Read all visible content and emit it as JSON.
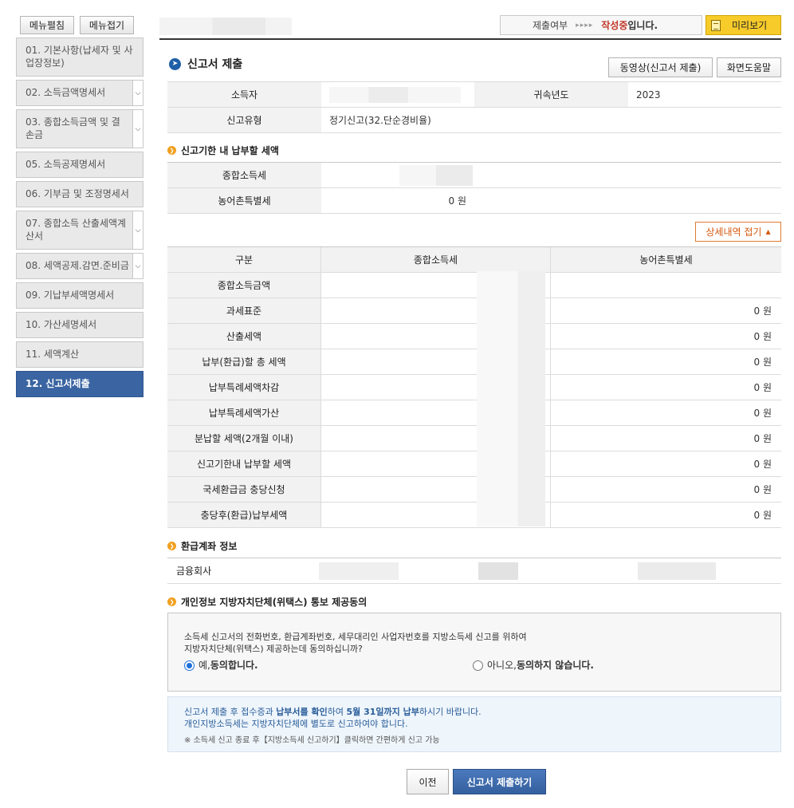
{
  "menu": {
    "expand_label": "메뉴펼침",
    "collapse_label": "메뉴접기",
    "items": [
      {
        "label": "01. 기본사항(납세자 및 사업장정보)"
      },
      {
        "label": "02. 소득금액명세서"
      },
      {
        "label": "03. 종합소득금액 및 결손금"
      },
      {
        "label": "05. 소득공제명세서"
      },
      {
        "label": "06. 기부금 및 조정명세서"
      },
      {
        "label": "07. 종합소득 산출세액계산서"
      },
      {
        "label": "08. 세액공제.감면.준비금"
      },
      {
        "label": "09. 기납부세액명세서"
      },
      {
        "label": "10. 가산세명세서"
      },
      {
        "label": "11. 세액계산"
      },
      {
        "label": "12. 신고서제출"
      }
    ]
  },
  "header": {
    "status_label": "제출여부",
    "status_arrows": "▸▸▸▸",
    "status_value": "작성중",
    "status_suffix": "입니다.",
    "preview_label": "미리보기"
  },
  "main": {
    "title": "신고서 제출",
    "video_button": "동영상(신고서 제출)",
    "help_button": "화면도움말",
    "info": {
      "income_earner_label": "소득자",
      "year_label": "귀속년도",
      "year_value": "2023",
      "report_type_label": "신고유형",
      "report_type_value": "정기신고(32.단순경비율)"
    },
    "due_section": {
      "title": "신고기한 내 납부할 세액",
      "global_income_tax_label": "종합소득세",
      "rural_tax_label": "농어촌특별세",
      "rural_tax_value": "0 원"
    },
    "detail_toggle": "상세내역 접기",
    "detail_table": {
      "headers": [
        "구분",
        "종합소득세",
        "농어촌특별세"
      ],
      "rows": [
        {
          "label": "종합소득금액",
          "rural": ""
        },
        {
          "label": "과세표준",
          "rural": "0 원"
        },
        {
          "label": "산출세액",
          "rural": "0 원"
        },
        {
          "label": "납부(환급)할 총 세액",
          "rural": "0 원"
        },
        {
          "label": "납부특례세액차감",
          "rural": "0 원"
        },
        {
          "label": "납부특례세액가산",
          "rural": "0 원"
        },
        {
          "label": "분납할 세액(2개월 이내)",
          "rural": "0 원"
        },
        {
          "label": "신고기한내 납부할 세액",
          "rural": "0 원"
        },
        {
          "label": "국세환급금 충당신청",
          "rural": "0 원"
        },
        {
          "label": "충당후(환급)납부세액",
          "rural": "0 원"
        }
      ]
    },
    "refund_section": {
      "title": "환급계좌 정보",
      "bank_label": "금융회사"
    },
    "consent_section": {
      "title": "개인정보 지방자치단체(위택스) 통보 제공동의",
      "text_line1": "소득세 신고서의 전화번호, 환급계좌번호, 세무대리인 사업자번호를 지방소득세 신고를 위하여",
      "text_line2": "지방자치단체(위택스) 제공하는데 동의하십니까?",
      "yes_prefix": "예, ",
      "yes_label": "동의합니다.",
      "no_prefix": "아니오, ",
      "no_label": "동의하지 않습니다."
    },
    "notice": {
      "line1_a": "신고서 제출 후 접수증과 ",
      "line1_b": "납부서를 확인",
      "line1_c": "하여 ",
      "line1_d": "5월 31일까지 납부",
      "line1_e": "하시기 바랍니다.",
      "line2": "개인지방소득세는 지방자치단체에 별도로 신고하여야 합니다.",
      "line3": "※ 소득세 신고 종료 후【지방소득세 신고하기】클릭하면 간편하게 신고 가능"
    },
    "prev_button": "이전",
    "submit_button": "신고서 제출하기"
  }
}
